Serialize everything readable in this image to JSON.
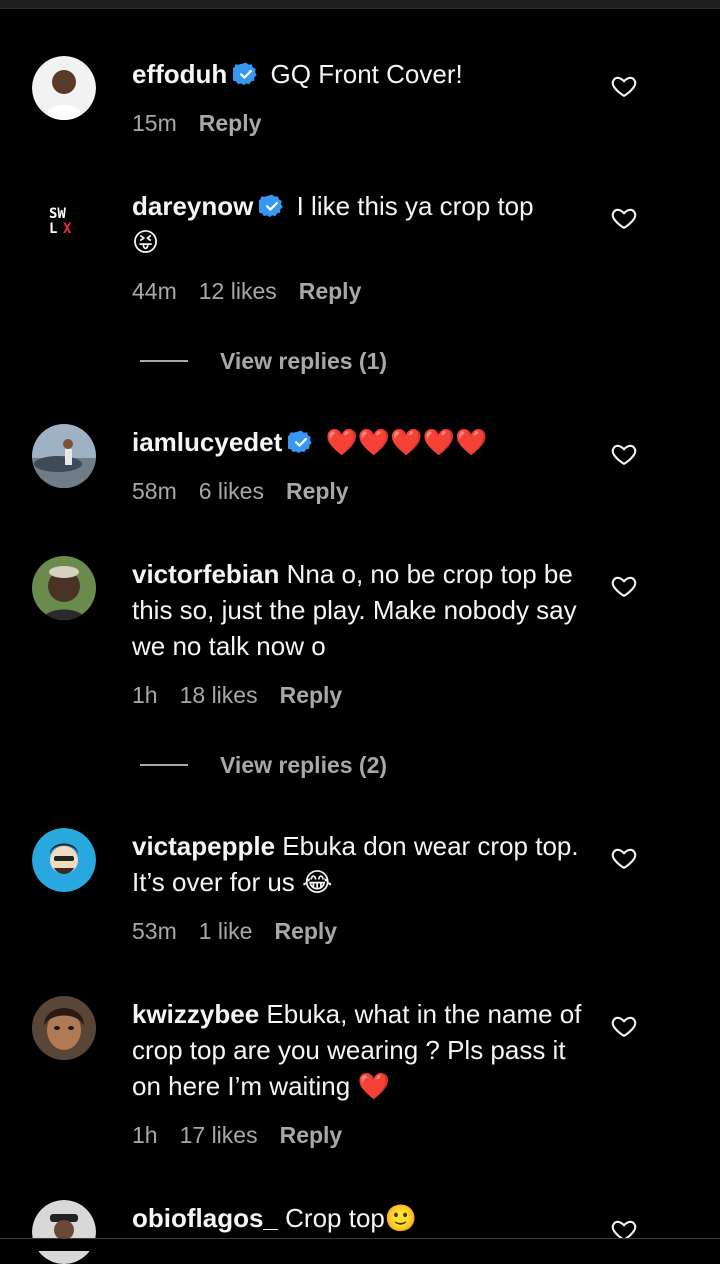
{
  "comments": [
    {
      "username": "effoduh",
      "verified": true,
      "text": "GQ Front Cover!",
      "time": "15m",
      "likes": "",
      "reply": "Reply"
    },
    {
      "username": "dareynow",
      "verified": true,
      "text": "I like this ya crop top",
      "emoji": "😝",
      "time": "44m",
      "likes": "12 likes",
      "reply": "Reply",
      "view_replies": "View replies (1)"
    },
    {
      "username": "iamlucyedet",
      "verified": true,
      "text": "",
      "emoji": "❤️❤️❤️❤️❤️",
      "time": "58m",
      "likes": "6 likes",
      "reply": "Reply"
    },
    {
      "username": "victorfebian",
      "verified": false,
      "text": "Nna o, no be crop top be this so, just the play. Make nobody say we no talk now o",
      "time": "1h",
      "likes": "18 likes",
      "reply": "Reply",
      "view_replies": "View replies (2)"
    },
    {
      "username": "victapepple",
      "verified": false,
      "text": "Ebuka don wear crop top. It’s over for us",
      "emoji": "😂",
      "time": "53m",
      "likes": "1 like",
      "reply": "Reply"
    },
    {
      "username": "kwizzybee",
      "verified": false,
      "text": "Ebuka, what in the name of crop top are you wearing ? Pls pass it on here I’m waiting",
      "emoji": "❤️",
      "time": "1h",
      "likes": "17 likes",
      "reply": "Reply"
    },
    {
      "username": "obioflagos_",
      "verified": false,
      "text": "Crop top",
      "emoji": "🙂",
      "time": "",
      "likes": "",
      "reply": ""
    }
  ],
  "icons": {
    "like": "heart-outline-icon",
    "verified": "verified-badge-icon"
  },
  "colors": {
    "background": "#000000",
    "verified": "#3897f0",
    "muted": "#a8a8a8",
    "heart": "#ed2a3a"
  }
}
